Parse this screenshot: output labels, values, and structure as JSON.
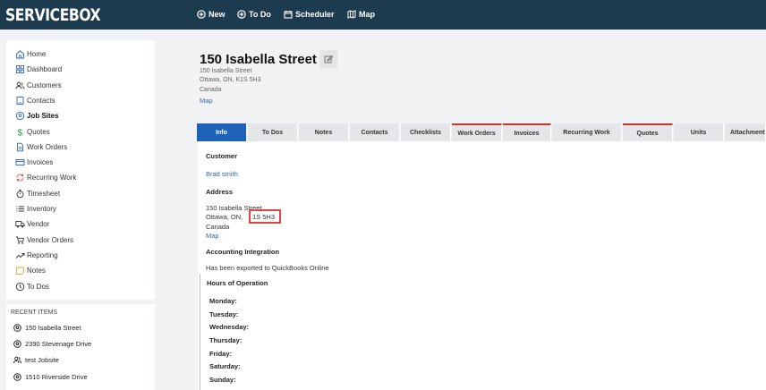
{
  "app": {
    "logo": "SERVICEBOX"
  },
  "topnav": [
    {
      "label": "New",
      "icon": "plus-circle-icon"
    },
    {
      "label": "To Do",
      "icon": "plus-circle-icon"
    },
    {
      "label": "Scheduler",
      "icon": "calendar-icon"
    },
    {
      "label": "Map",
      "icon": "map-icon"
    }
  ],
  "sidebar": {
    "items": [
      {
        "label": "Home",
        "icon": "home-icon"
      },
      {
        "label": "Dashboard",
        "icon": "dashboard-icon"
      },
      {
        "label": "Customers",
        "icon": "customers-icon"
      },
      {
        "label": "Contacts",
        "icon": "contacts-icon"
      },
      {
        "label": "Job Sites",
        "icon": "location-pin-icon",
        "active": true
      },
      {
        "label": "Quotes",
        "icon": "dollar-icon"
      },
      {
        "label": "Work Orders",
        "icon": "document-icon"
      },
      {
        "label": "Invoices",
        "icon": "invoice-icon"
      },
      {
        "label": "Recurring Work",
        "icon": "recurring-icon"
      },
      {
        "label": "Timesheet",
        "icon": "stopwatch-icon"
      },
      {
        "label": "Inventory",
        "icon": "list-icon"
      },
      {
        "label": "Vendor",
        "icon": "truck-icon"
      },
      {
        "label": "Vendor Orders",
        "icon": "cart-icon"
      },
      {
        "label": "Reporting",
        "icon": "trend-icon"
      },
      {
        "label": "Notes",
        "icon": "note-icon"
      },
      {
        "label": "To Dos",
        "icon": "clock-icon"
      }
    ]
  },
  "recent": {
    "title": "RECENT ITEMS",
    "items": [
      {
        "label": "150 Isabella Street",
        "icon": "location-pin-icon"
      },
      {
        "label": "2390 Stevenage Drive",
        "icon": "location-pin-icon"
      },
      {
        "label": "test Jobsite",
        "icon": "customers-icon"
      },
      {
        "label": "1510 Riverside Drive",
        "icon": "location-pin-icon"
      }
    ]
  },
  "header": {
    "title": "150 Isabella Street",
    "address_lines": [
      "150 Isabella Street",
      "Ottawa, ON, K1S 5H3",
      "Canada"
    ],
    "map_link": "Map"
  },
  "tabs": [
    {
      "label": "Info",
      "active": true
    },
    {
      "label": "To Dos"
    },
    {
      "label": "Notes"
    },
    {
      "label": "Contacts"
    },
    {
      "label": "Checklists"
    },
    {
      "label": "Work Orders",
      "flag": true
    },
    {
      "label": "Invoices",
      "flag": true
    },
    {
      "label": "Recurring Work"
    },
    {
      "label": "Quotes",
      "flag": true
    },
    {
      "label": "Units"
    },
    {
      "label": "Attachments"
    }
  ],
  "info": {
    "customer_heading": "Customer",
    "customer_name": "Brad smith",
    "address_heading": "Address",
    "address_street": "150 Isabella Street",
    "address_city": "Ottawa, ON, ",
    "address_postal": "1S 5H3",
    "address_country": "Canada",
    "address_map": "Map",
    "accounting_heading": "Accounting Integration",
    "accounting_status": "Has been exported to QuickBooks Online",
    "hours_heading": "Hours of Operation",
    "days": [
      "Monday:",
      "Tuesday:",
      "Wednesday:",
      "Thursday:",
      "Friday:",
      "Saturday:",
      "Sunday:"
    ]
  },
  "colors": {
    "topbar": "#1d3b4e",
    "active_tab": "#1c62b8",
    "link": "#2f67b5",
    "highlight": "#e04545",
    "flag": "#c0392b"
  }
}
